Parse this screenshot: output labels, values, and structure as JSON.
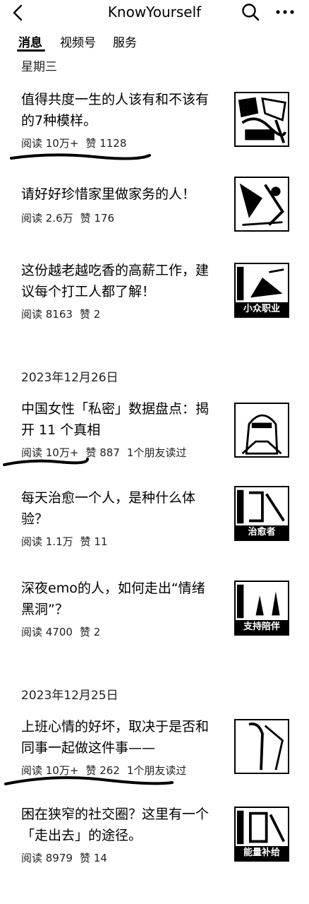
{
  "header": {
    "title": "KnowYourself"
  },
  "tabs": [
    {
      "label": "消息"
    },
    {
      "label": "视频号"
    },
    {
      "label": "服务"
    }
  ],
  "dates": [
    "星期三",
    "2023年12月26日",
    "2023年12月25日"
  ],
  "articles": [
    {
      "title_line1": "值得共度一生的人该有和不该有",
      "title_line2": "的7种模样。",
      "reads": "阅读 10万+",
      "likes": "赞 1128",
      "friends": "",
      "thumb_label": ""
    },
    {
      "title_line1": "请好好珍惜家里做家务的人！",
      "title_line2": "",
      "reads": "阅读 2.6万",
      "likes": "赞 176",
      "friends": "",
      "thumb_label": ""
    },
    {
      "title_line1": "这份越老越吃香的高薪工作，建",
      "title_line2": "议每个打工人都了解！",
      "reads": "阅读 8163",
      "likes": "赞 2",
      "friends": "",
      "thumb_label": "小众职业"
    },
    {
      "title_line1": "中国女性「私密」数据盘点：揭",
      "title_line2": "开 11 个真相",
      "reads": "阅读 10万+",
      "likes": "赞 887",
      "friends": "1个朋友读过",
      "thumb_label": ""
    },
    {
      "title_line1": "每天治愈一个人，是种什么体",
      "title_line2": "验？",
      "reads": "阅读 1.1万",
      "likes": "赞 11",
      "friends": "",
      "thumb_label": "治愈者"
    },
    {
      "title_line1": "深夜emo的人，如何走出“情绪",
      "title_line2": "黑洞”？",
      "reads": "阅读 4700",
      "likes": "赞 2",
      "friends": "",
      "thumb_label": "支持陪伴"
    },
    {
      "title_line1": "上班心情的好坏，取决于是否和",
      "title_line2": "同事一起做这件事——",
      "reads": "阅读 10万+",
      "likes": "赞 262",
      "friends": "1个朋友读过",
      "thumb_label": ""
    },
    {
      "title_line1": "困在狭窄的社交圈？这里有一个",
      "title_line2": "「走出去」的途径。",
      "reads": "阅读 8979",
      "likes": "赞 14",
      "friends": "",
      "thumb_label": "能量补给"
    }
  ],
  "icons": {
    "back": "chevron-left-icon",
    "search": "search-icon",
    "more": "more-icon"
  }
}
